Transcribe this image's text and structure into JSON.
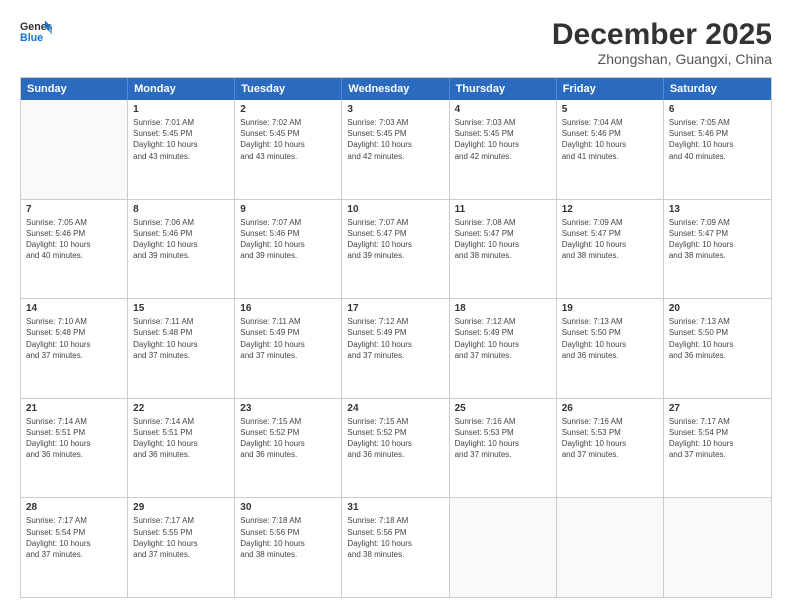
{
  "header": {
    "logo_line1": "General",
    "logo_line2": "Blue",
    "month": "December 2025",
    "location": "Zhongshan, Guangxi, China"
  },
  "weekdays": [
    "Sunday",
    "Monday",
    "Tuesday",
    "Wednesday",
    "Thursday",
    "Friday",
    "Saturday"
  ],
  "rows": [
    [
      {
        "day": "",
        "text": ""
      },
      {
        "day": "1",
        "text": "Sunrise: 7:01 AM\nSunset: 5:45 PM\nDaylight: 10 hours\nand 43 minutes."
      },
      {
        "day": "2",
        "text": "Sunrise: 7:02 AM\nSunset: 5:45 PM\nDaylight: 10 hours\nand 43 minutes."
      },
      {
        "day": "3",
        "text": "Sunrise: 7:03 AM\nSunset: 5:45 PM\nDaylight: 10 hours\nand 42 minutes."
      },
      {
        "day": "4",
        "text": "Sunrise: 7:03 AM\nSunset: 5:45 PM\nDaylight: 10 hours\nand 42 minutes."
      },
      {
        "day": "5",
        "text": "Sunrise: 7:04 AM\nSunset: 5:46 PM\nDaylight: 10 hours\nand 41 minutes."
      },
      {
        "day": "6",
        "text": "Sunrise: 7:05 AM\nSunset: 5:46 PM\nDaylight: 10 hours\nand 40 minutes."
      }
    ],
    [
      {
        "day": "7",
        "text": "Sunrise: 7:05 AM\nSunset: 5:46 PM\nDaylight: 10 hours\nand 40 minutes."
      },
      {
        "day": "8",
        "text": "Sunrise: 7:06 AM\nSunset: 5:46 PM\nDaylight: 10 hours\nand 39 minutes."
      },
      {
        "day": "9",
        "text": "Sunrise: 7:07 AM\nSunset: 5:46 PM\nDaylight: 10 hours\nand 39 minutes."
      },
      {
        "day": "10",
        "text": "Sunrise: 7:07 AM\nSunset: 5:47 PM\nDaylight: 10 hours\nand 39 minutes."
      },
      {
        "day": "11",
        "text": "Sunrise: 7:08 AM\nSunset: 5:47 PM\nDaylight: 10 hours\nand 38 minutes."
      },
      {
        "day": "12",
        "text": "Sunrise: 7:09 AM\nSunset: 5:47 PM\nDaylight: 10 hours\nand 38 minutes."
      },
      {
        "day": "13",
        "text": "Sunrise: 7:09 AM\nSunset: 5:47 PM\nDaylight: 10 hours\nand 38 minutes."
      }
    ],
    [
      {
        "day": "14",
        "text": "Sunrise: 7:10 AM\nSunset: 5:48 PM\nDaylight: 10 hours\nand 37 minutes."
      },
      {
        "day": "15",
        "text": "Sunrise: 7:11 AM\nSunset: 5:48 PM\nDaylight: 10 hours\nand 37 minutes."
      },
      {
        "day": "16",
        "text": "Sunrise: 7:11 AM\nSunset: 5:49 PM\nDaylight: 10 hours\nand 37 minutes."
      },
      {
        "day": "17",
        "text": "Sunrise: 7:12 AM\nSunset: 5:49 PM\nDaylight: 10 hours\nand 37 minutes."
      },
      {
        "day": "18",
        "text": "Sunrise: 7:12 AM\nSunset: 5:49 PM\nDaylight: 10 hours\nand 37 minutes."
      },
      {
        "day": "19",
        "text": "Sunrise: 7:13 AM\nSunset: 5:50 PM\nDaylight: 10 hours\nand 36 minutes."
      },
      {
        "day": "20",
        "text": "Sunrise: 7:13 AM\nSunset: 5:50 PM\nDaylight: 10 hours\nand 36 minutes."
      }
    ],
    [
      {
        "day": "21",
        "text": "Sunrise: 7:14 AM\nSunset: 5:51 PM\nDaylight: 10 hours\nand 36 minutes."
      },
      {
        "day": "22",
        "text": "Sunrise: 7:14 AM\nSunset: 5:51 PM\nDaylight: 10 hours\nand 36 minutes."
      },
      {
        "day": "23",
        "text": "Sunrise: 7:15 AM\nSunset: 5:52 PM\nDaylight: 10 hours\nand 36 minutes."
      },
      {
        "day": "24",
        "text": "Sunrise: 7:15 AM\nSunset: 5:52 PM\nDaylight: 10 hours\nand 36 minutes."
      },
      {
        "day": "25",
        "text": "Sunrise: 7:16 AM\nSunset: 5:53 PM\nDaylight: 10 hours\nand 37 minutes."
      },
      {
        "day": "26",
        "text": "Sunrise: 7:16 AM\nSunset: 5:53 PM\nDaylight: 10 hours\nand 37 minutes."
      },
      {
        "day": "27",
        "text": "Sunrise: 7:17 AM\nSunset: 5:54 PM\nDaylight: 10 hours\nand 37 minutes."
      }
    ],
    [
      {
        "day": "28",
        "text": "Sunrise: 7:17 AM\nSunset: 5:54 PM\nDaylight: 10 hours\nand 37 minutes."
      },
      {
        "day": "29",
        "text": "Sunrise: 7:17 AM\nSunset: 5:55 PM\nDaylight: 10 hours\nand 37 minutes."
      },
      {
        "day": "30",
        "text": "Sunrise: 7:18 AM\nSunset: 5:56 PM\nDaylight: 10 hours\nand 38 minutes."
      },
      {
        "day": "31",
        "text": "Sunrise: 7:18 AM\nSunset: 5:56 PM\nDaylight: 10 hours\nand 38 minutes."
      },
      {
        "day": "",
        "text": ""
      },
      {
        "day": "",
        "text": ""
      },
      {
        "day": "",
        "text": ""
      }
    ]
  ]
}
